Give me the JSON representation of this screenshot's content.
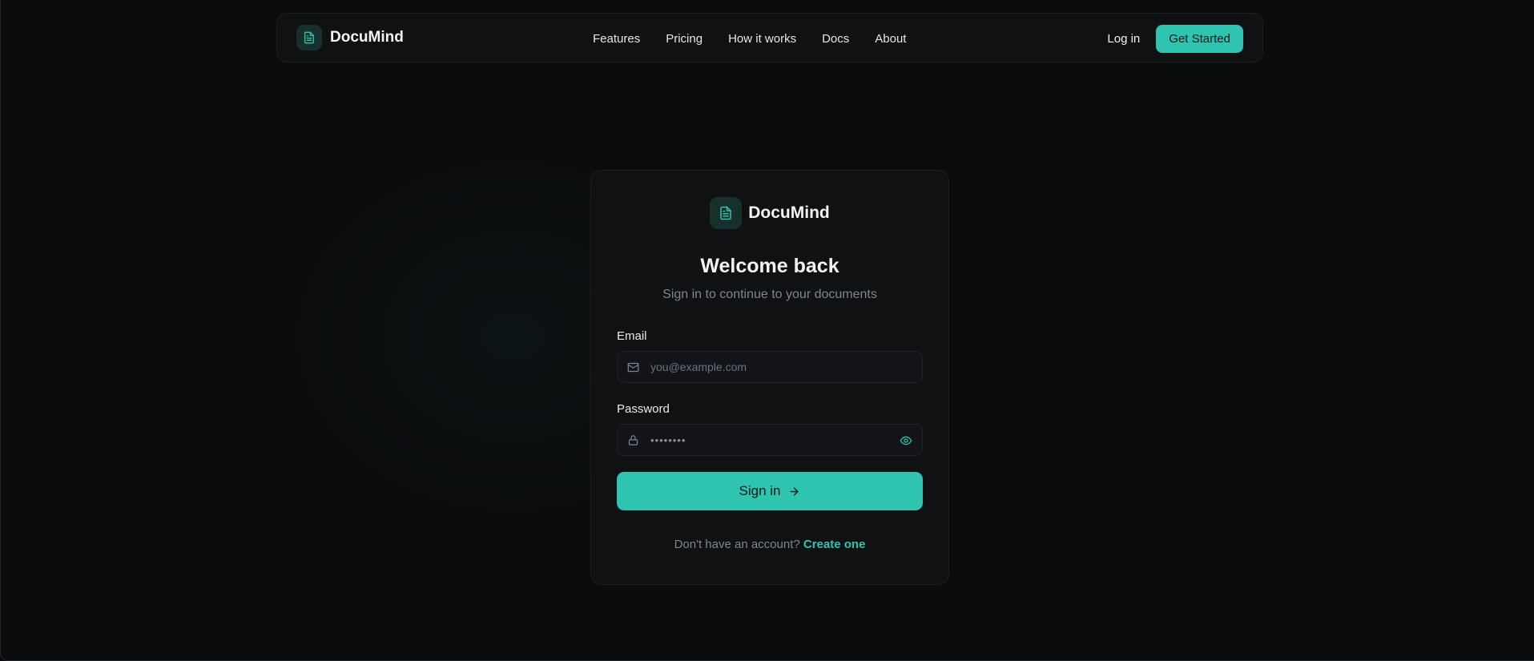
{
  "brand": {
    "name": "DocuMind",
    "logo_icon": "document-icon",
    "accent_color": "#2ec4b0"
  },
  "nav": {
    "links": [
      "Features",
      "Pricing",
      "How it works",
      "Docs",
      "About"
    ],
    "login_label": "Log in",
    "cta_label": "Get Started"
  },
  "login": {
    "brand_name": "DocuMind",
    "title": "Welcome back",
    "subtitle": "Sign in to continue to your documents",
    "email": {
      "label": "Email",
      "placeholder": "you@example.com",
      "value": "",
      "icon": "mail-icon"
    },
    "password": {
      "label": "Password",
      "masked_value": "••••••••",
      "icon": "lock-icon",
      "toggle_icon": "eye-icon"
    },
    "submit_label": "Sign in",
    "submit_icon": "arrow-right-icon",
    "signup_prompt": "Don't have an account?",
    "signup_link": "Create one"
  }
}
